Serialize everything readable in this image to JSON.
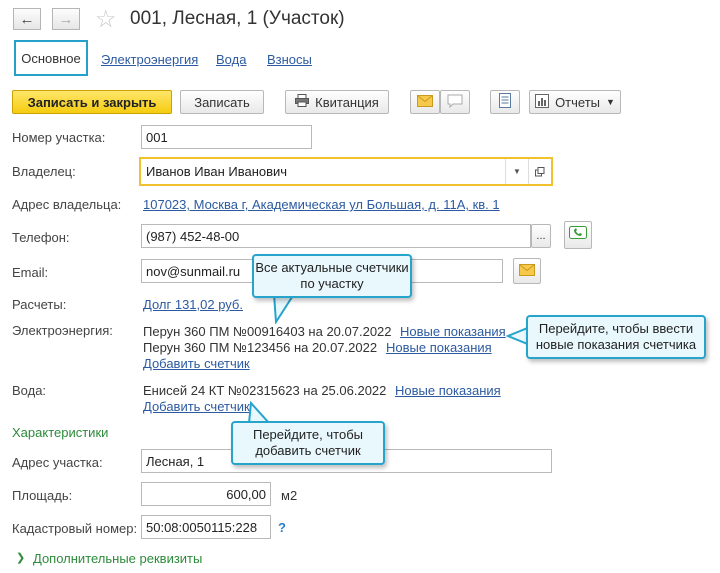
{
  "header": {
    "back_icon": "arrow-left-icon",
    "forward_icon": "arrow-right-icon",
    "star_icon": "star-icon",
    "title": "001, Лесная, 1 (Участок)"
  },
  "tabs": [
    {
      "label": "Основное",
      "active": true
    },
    {
      "label": "Электроэнергия"
    },
    {
      "label": "Вода"
    },
    {
      "label": "Взносы"
    }
  ],
  "toolbar": {
    "save_close": "Записать и закрыть",
    "save": "Записать",
    "receipt": "Квитанция",
    "reports": "Отчеты",
    "accent": "#f5cc10"
  },
  "form": {
    "plot_number_label": "Номер участка:",
    "plot_number": "001",
    "owner_label": "Владелец:",
    "owner": "Иванов Иван Иванович",
    "owner_address_label": "Адрес владельца:",
    "owner_address": "107023, Москва г, Академическая ул Большая, д. 11А, кв. 1",
    "phone_label": "Телефон:",
    "phone": "(987) 452-48-00",
    "phone_more": "...",
    "email_label": "Email:",
    "email": "nov@sunmail.ru",
    "payments_label": "Расчеты:",
    "payments": "Долг 131,02 руб.",
    "electricity_label": "Электроэнергия:",
    "electricity_meters": [
      {
        "text": "Перун 360 ПМ №00916403 на 20.07.2022",
        "link": "Новые показания"
      },
      {
        "text": "Перун 360 ПМ №123456 на 20.07.2022",
        "link": "Новые показания"
      }
    ],
    "add_meter": "Добавить счетчик",
    "water_label": "Вода:",
    "water_meters": [
      {
        "text": "Енисей 24 КТ №02315623 на 25.06.2022",
        "link": "Новые показания"
      }
    ],
    "characteristics": "Характеристики",
    "plot_address_label": "Адрес участка:",
    "plot_address": "Лесная, 1",
    "area_label": "Площадь:",
    "area": "600,00",
    "area_unit": "м2",
    "cadastral_label": "Кадастровый номер:",
    "cadastral": "50:08:0050115:228",
    "cadastral_help": "?",
    "extra": "Дополнительные реквизиты"
  },
  "callouts": {
    "meters": "Все актуальные счетчики по участку",
    "new_readings": "Перейдите, чтобы ввести новые показания счетчика",
    "add_meter": "Перейдите, чтобы добавить счетчик"
  }
}
